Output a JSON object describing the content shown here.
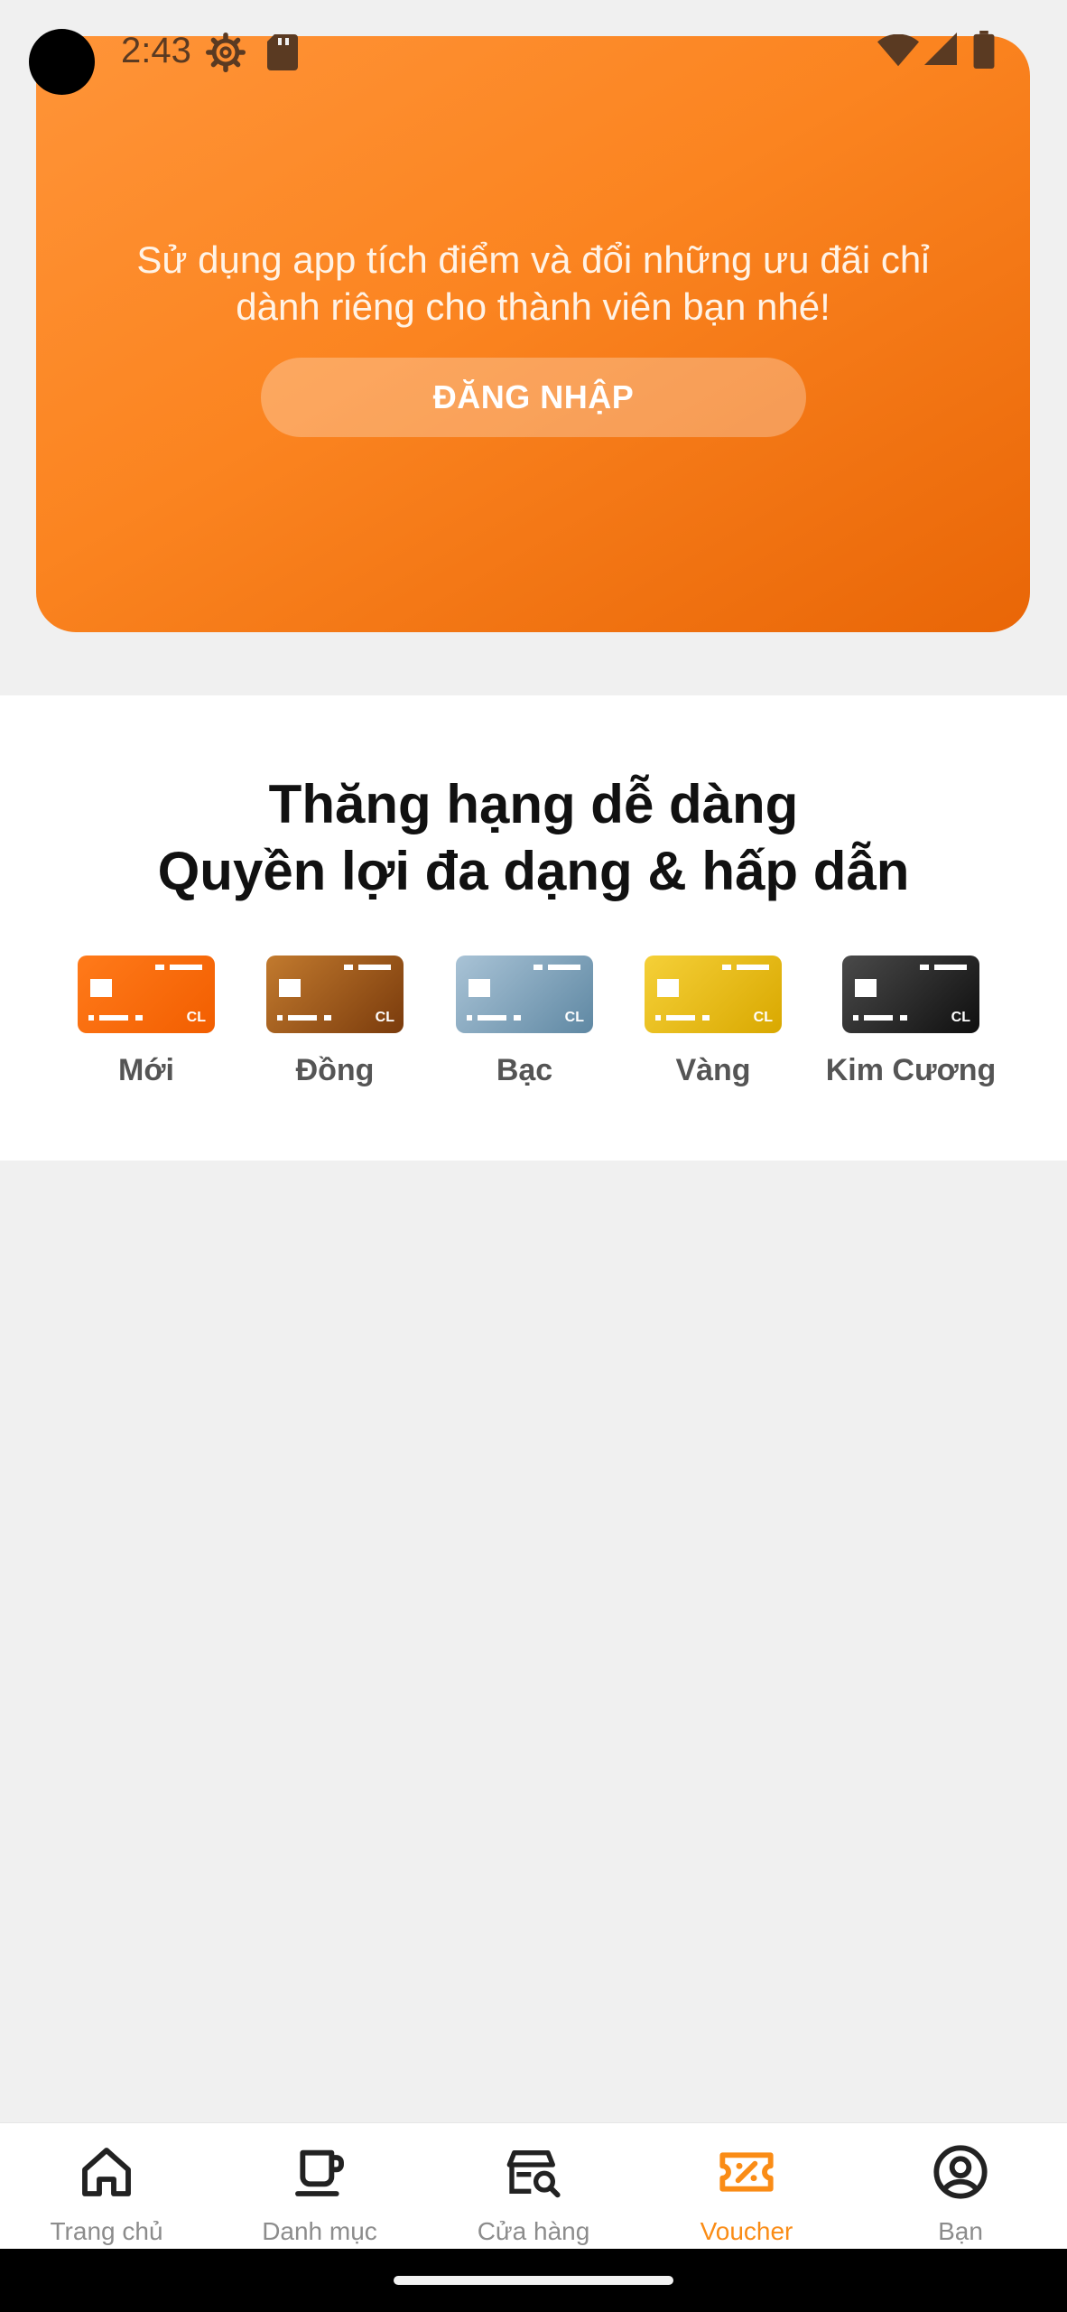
{
  "status_bar": {
    "time": "2:43",
    "icons": [
      "gear-icon",
      "sd-card-icon",
      "wifi-icon",
      "signal-icon",
      "battery-icon"
    ]
  },
  "hero": {
    "line1": "Sử dụng app tích điểm và đổi những ưu đãi chỉ",
    "line2": "dành riêng cho thành viên bạn nhé!",
    "login_label": "ĐĂNG NHẬP",
    "gradient_colors": [
      "#ff9438",
      "#e96607"
    ]
  },
  "tiers": {
    "title_line1": "Thăng hạng dễ dàng",
    "title_line2": "Quyền lợi đa dạng & hấp dẫn",
    "items": [
      {
        "label": "Mới",
        "card_text": "CL",
        "colors": [
          "#ff7a1a",
          "#f25e00"
        ]
      },
      {
        "label": "Đồng",
        "card_text": "CL",
        "colors": [
          "#c27a2e",
          "#7a3b0c"
        ]
      },
      {
        "label": "Bạc",
        "card_text": "CL",
        "colors": [
          "#a9c3d6",
          "#5f88a3"
        ]
      },
      {
        "label": "Vàng",
        "card_text": "CL",
        "colors": [
          "#f5d038",
          "#d9a800"
        ]
      },
      {
        "label": "Kim Cương",
        "card_text": "CL",
        "colors": [
          "#4a4a4a",
          "#0f0f0f"
        ]
      }
    ]
  },
  "bottom_nav": {
    "items": [
      {
        "label": "Trang chủ",
        "icon": "home-icon"
      },
      {
        "label": "Danh mục",
        "icon": "cup-icon"
      },
      {
        "label": "Cửa hàng",
        "icon": "store-search-icon"
      },
      {
        "label": "Voucher",
        "icon": "voucher-icon",
        "active": true
      },
      {
        "label": "Bạn",
        "icon": "user-icon"
      }
    ],
    "active_color": "#fa8c16",
    "inactive_color": "#8c8c8c"
  }
}
